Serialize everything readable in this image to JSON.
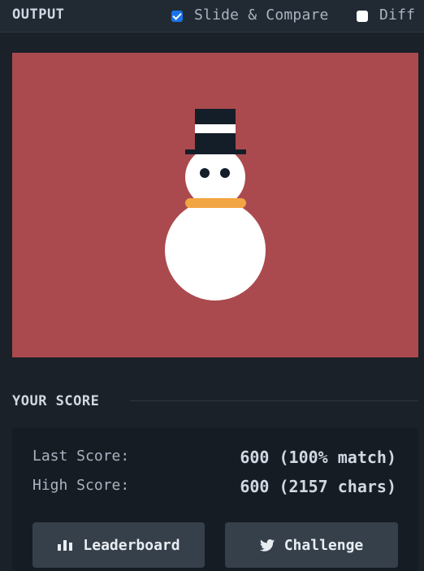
{
  "header": {
    "title": "OUTPUT",
    "slide_compare": {
      "label": "Slide & Compare",
      "checked": true
    },
    "diff": {
      "label": "Diff",
      "checked": false
    }
  },
  "canvas": {
    "background": "#ab4a4e",
    "colors": {
      "hat": "#131e29",
      "hat_band": "#ffffff",
      "snow": "#ffffff",
      "eyes": "#131e29",
      "scarf": "#f3a443"
    }
  },
  "score": {
    "heading": "YOUR SCORE",
    "last_score_label": "Last Score:",
    "last_score_value": "600 (100% match)",
    "high_score_label": "High Score:",
    "high_score_value": "600 (2157 chars)",
    "buttons": {
      "leaderboard": {
        "label": "Leaderboard",
        "icon": "bar-chart-icon"
      },
      "challenge": {
        "label": "Challenge",
        "icon": "twitter-icon"
      }
    }
  }
}
